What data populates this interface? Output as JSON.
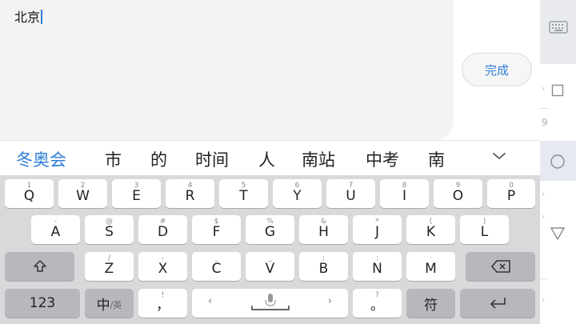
{
  "editor": {
    "text": "北京"
  },
  "done_button": {
    "label": "完成"
  },
  "candidates": [
    "冬奥会",
    "市",
    "的",
    "时间",
    "人",
    "南站",
    "中考",
    "南"
  ],
  "keyboard": {
    "row1": [
      {
        "letter": "Q",
        "sub": "1"
      },
      {
        "letter": "W",
        "sub": "2"
      },
      {
        "letter": "E",
        "sub": "3"
      },
      {
        "letter": "R",
        "sub": "4"
      },
      {
        "letter": "T",
        "sub": "5"
      },
      {
        "letter": "Y",
        "sub": "6"
      },
      {
        "letter": "U",
        "sub": "7"
      },
      {
        "letter": "I",
        "sub": "8"
      },
      {
        "letter": "O",
        "sub": "9"
      },
      {
        "letter": "P",
        "sub": "0"
      }
    ],
    "row2": [
      {
        "letter": "A",
        "sub": "-"
      },
      {
        "letter": "S",
        "sub": "@"
      },
      {
        "letter": "D",
        "sub": "#"
      },
      {
        "letter": "F",
        "sub": "$"
      },
      {
        "letter": "G",
        "sub": "%"
      },
      {
        "letter": "H",
        "sub": "&"
      },
      {
        "letter": "J",
        "sub": "*"
      },
      {
        "letter": "K",
        "sub": "("
      },
      {
        "letter": "L",
        "sub": ")"
      }
    ],
    "row3": [
      {
        "letter": "Z",
        "sub": "/"
      },
      {
        "letter": "X",
        "sub": "-"
      },
      {
        "letter": "C",
        "sub": "_"
      },
      {
        "letter": "V",
        "sub": "_"
      },
      {
        "letter": "B",
        "sub": ";"
      },
      {
        "letter": "N",
        "sub": ":"
      },
      {
        "letter": "M",
        "sub": "·"
      }
    ],
    "num_label": "123",
    "lang_main": "中",
    "lang_sub": "/英",
    "comma_main": "，",
    "comma_sub": "!",
    "period_main": "。",
    "period_sub": "?",
    "symbol_label": "符",
    "space_left": "‹",
    "space_right": "›"
  },
  "icons": {
    "shift": "shift-icon",
    "backspace": "backspace-icon",
    "mic": "mic-icon",
    "enter": "enter-icon",
    "keyboard": "keyboard-icon"
  },
  "colors": {
    "accent": "#2f7ed8",
    "key": "#ffffff",
    "dark_key": "#b6b8bc",
    "keyboard_bg": "#d8d9db"
  }
}
